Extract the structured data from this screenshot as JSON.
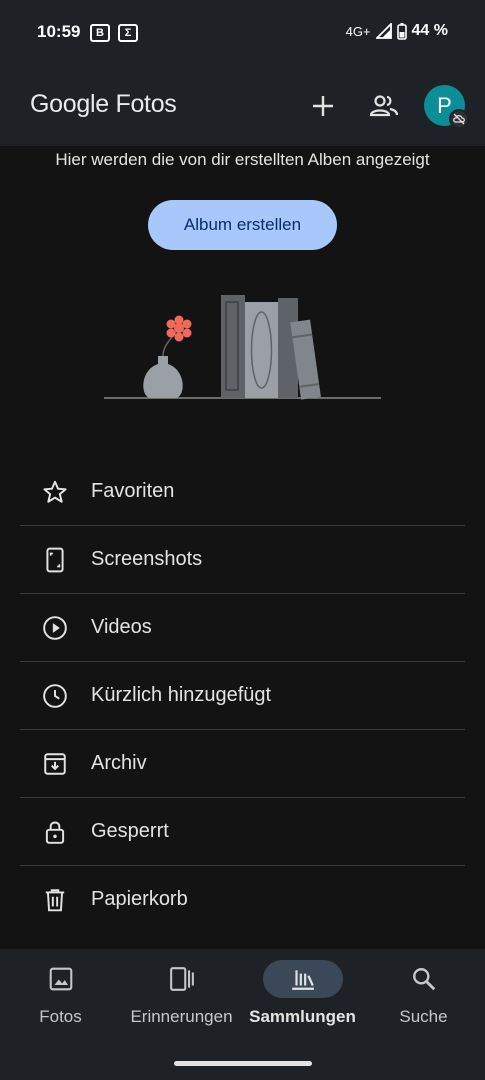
{
  "status_bar": {
    "time": "10:59",
    "left_icons": [
      "bild-icon",
      "sigma-icon"
    ],
    "network": "4G+",
    "battery": "44 %"
  },
  "app_bar": {
    "logo_brand": "Google",
    "logo_product": "Fotos",
    "avatar_letter": "P"
  },
  "empty_state": {
    "hint": "Hier werden die von dir erstellten Alben angezeigt",
    "create_button": "Album erstellen"
  },
  "collections": [
    {
      "label": "Favoriten",
      "icon": "star-icon"
    },
    {
      "label": "Screenshots",
      "icon": "phone-screenshot-icon"
    },
    {
      "label": "Videos",
      "icon": "play-circle-icon"
    },
    {
      "label": "Kürzlich hinzugefügt",
      "icon": "clock-icon"
    },
    {
      "label": "Archiv",
      "icon": "archive-icon"
    },
    {
      "label": "Gesperrt",
      "icon": "lock-icon"
    },
    {
      "label": "Papierkorb",
      "icon": "trash-icon"
    }
  ],
  "bottom_nav": [
    {
      "label": "Fotos",
      "icon": "photo-icon",
      "active": false
    },
    {
      "label": "Erinnerungen",
      "icon": "memories-icon",
      "active": false
    },
    {
      "label": "Sammlungen",
      "icon": "library-icon",
      "active": true
    },
    {
      "label": "Suche",
      "icon": "search-icon",
      "active": false
    }
  ],
  "colors": {
    "background": "#131313",
    "bar": "#1e2227",
    "accent_button": "#a8c7fa",
    "avatar": "#0b8e98",
    "active_pill": "#3b4858",
    "flower": "#f06a5a"
  }
}
